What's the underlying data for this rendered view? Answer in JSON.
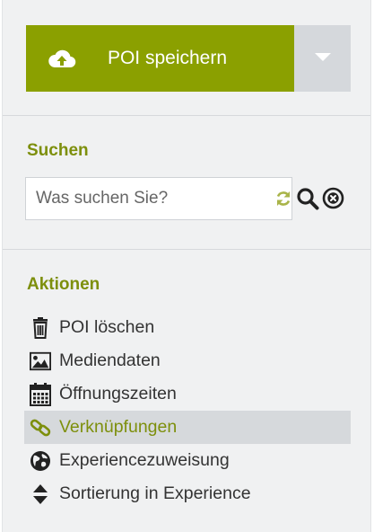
{
  "save": {
    "label": "POI speichern",
    "icon": "cloud-upload-icon",
    "toggle_icon": "caret-down-icon",
    "color": "#8ba000"
  },
  "search": {
    "title": "Suchen",
    "placeholder": "Was suchen Sie?",
    "value": "",
    "icons": [
      "refresh-icon",
      "search-icon",
      "clear-icon"
    ]
  },
  "actions": {
    "title": "Aktionen",
    "items": [
      {
        "label": "POI löschen",
        "icon": "trash-icon"
      },
      {
        "label": "Mediendaten",
        "icon": "image-icon"
      },
      {
        "label": "Öffnungszeiten",
        "icon": "calendar-icon"
      },
      {
        "label": "Verknüpfungen",
        "icon": "link-icon",
        "active": true
      },
      {
        "label": "Experiencezuweisung",
        "icon": "globe-icon"
      },
      {
        "label": "Sortierung in Experience",
        "icon": "sort-icon"
      }
    ]
  },
  "colors": {
    "accent": "#8ba000",
    "accent_text": "#7d8f0c",
    "active_bg": "#d6d9dc",
    "panel_bg": "#f0f1f2"
  }
}
